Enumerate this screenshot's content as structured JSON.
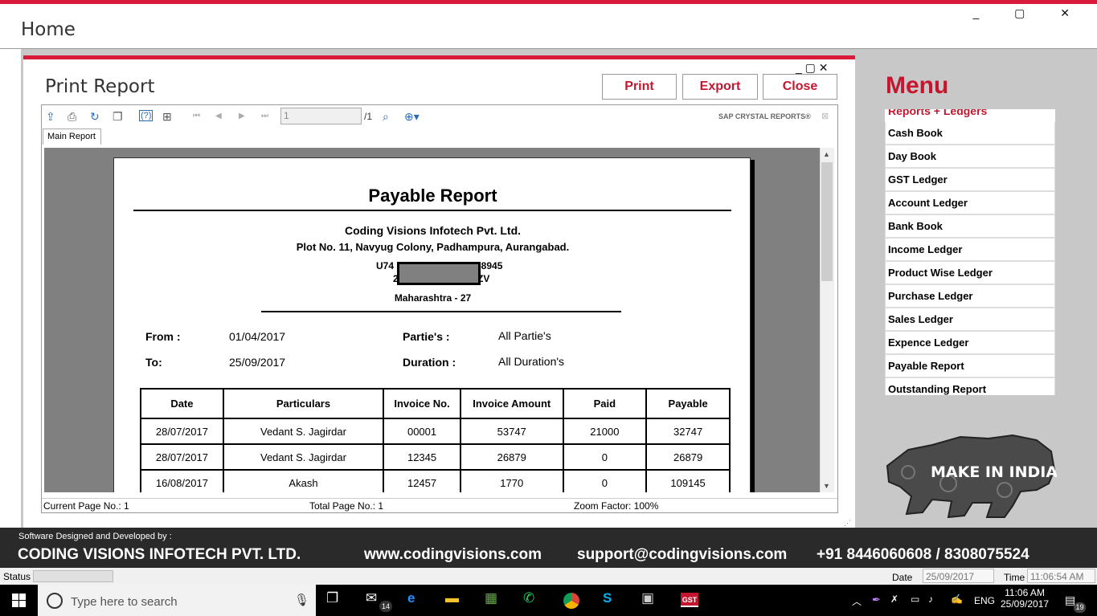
{
  "window": {
    "title": "Home",
    "controls": "_ ▢ ✕"
  },
  "menu": {
    "title": "Menu",
    "header": "Reports + Ledgers",
    "items": [
      "Cash Book",
      "Day Book",
      "GST Ledger",
      "Account Ledger",
      "Bank Book",
      "Income Ledger",
      "Product Wise Ledger",
      "Purchase Ledger",
      "Sales Ledger",
      "Expence Ledger",
      "Payable Report",
      "Outstanding Report"
    ]
  },
  "badge": {
    "text": "MAKE IN INDIA"
  },
  "dialog": {
    "title": "Print Report",
    "controls": "_ ▢ ✕",
    "print_label": "Print",
    "export_label": "Export",
    "close_label": "Close"
  },
  "viewer": {
    "page_value": "1",
    "page_total": "/1",
    "brand": "SAP CRYSTAL REPORTS®",
    "tab": "Main Report",
    "status": {
      "current": "Current Page No.: 1",
      "total": "Total Page No.: 1",
      "zoom": "Zoom Factor: 100%"
    }
  },
  "report": {
    "title": "Payable Report",
    "company": "Coding Visions Infotech Pvt. Ltd.",
    "address": "Plot No. 11, Navyug Colony, Padhampura, Aurangabad.",
    "cin_a": "U74",
    "cin_b": "58945",
    "cin_c": "2",
    "cin_d": "ZV",
    "state": "Maharashtra - 27",
    "from_label": "From :",
    "from_value": "01/04/2017",
    "to_label": "To:",
    "to_value": "25/09/2017",
    "parties_label": "Partie's :",
    "parties_value": "All Partie's",
    "duration_label": "Duration :",
    "duration_value": "All Duration's",
    "columns": [
      "Date",
      "Particulars",
      "Invoice No.",
      "Invoice Amount",
      "Paid",
      "Payable"
    ],
    "rows": [
      [
        "28/07/2017",
        "Vedant S. Jagirdar",
        "00001",
        "53747",
        "21000",
        "32747"
      ],
      [
        "28/07/2017",
        "Vedant S. Jagirdar",
        "12345",
        "26879",
        "0",
        "26879"
      ],
      [
        "16/08/2017",
        "Akash",
        "12457",
        "1770",
        "0",
        "109145"
      ]
    ]
  },
  "footer": {
    "small": "Software Designed and Developed by :",
    "company": "CODING VISIONS INFOTECH PVT. LTD.",
    "website": "www.codingvisions.com",
    "email": "support@codingvisions.com",
    "phone": "+91 8446060608 / 8308075524"
  },
  "appstatus": {
    "status_label": "Status",
    "date_label": "Date",
    "date_value": "25/09/2017",
    "time_label": "Time",
    "time_value": "11:06:54 AM"
  },
  "taskbar": {
    "search_placeholder": "Type here to search",
    "mail_badge": "14",
    "gst_label": "GST",
    "lang": "ENG",
    "time": "11:06 AM",
    "date": "25/09/2017",
    "notif_count": "19"
  }
}
